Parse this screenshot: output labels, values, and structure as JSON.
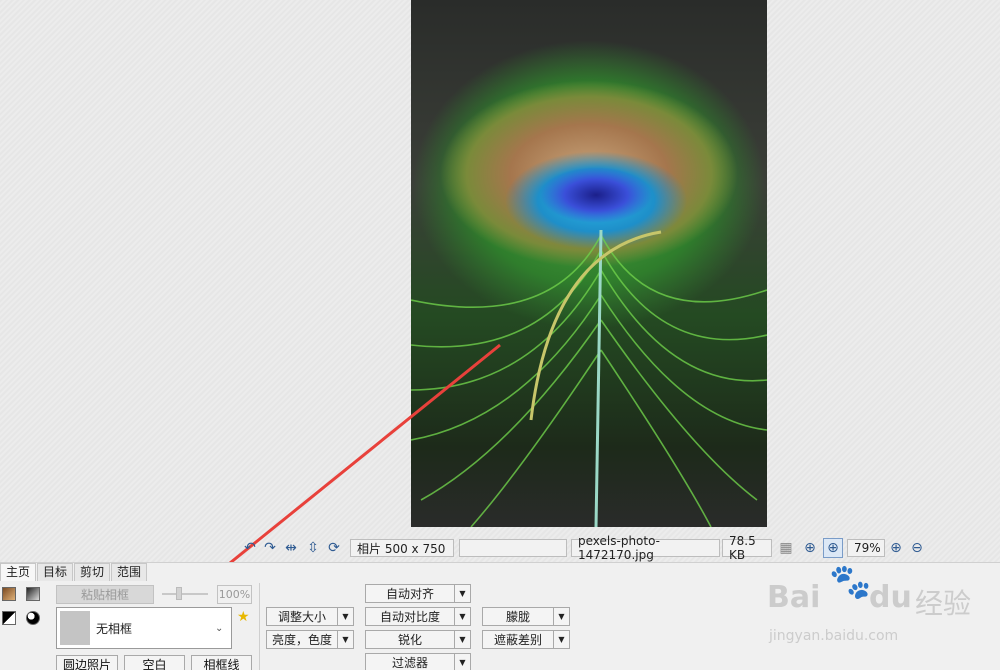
{
  "status_bar": {
    "image_size": "相片 500 x 750",
    "empty_field": "",
    "filename": "pexels-photo-1472170.jpg",
    "file_size": "78.5 KB",
    "zoom": "79%"
  },
  "tabs": [
    {
      "label": "主页"
    },
    {
      "label": "目标"
    },
    {
      "label": "剪切"
    },
    {
      "label": "范围"
    }
  ],
  "panel": {
    "paste_frame": "粘贴相框",
    "opacity": "100%",
    "frame_selected": "无相框",
    "round_photo": "圆边照片",
    "blank": "空白",
    "frame_line": "相框线",
    "resize": "调整大小",
    "brightness_color": "亮度，色度",
    "auto_align": "自动对齐",
    "auto_contrast": "自动对比度",
    "sharpen": "锐化",
    "filter": "过滤器",
    "blur": "朦胧",
    "mask_diff": "遮蔽差别"
  },
  "watermark": {
    "brand": "Bai",
    "brand2": "du",
    "suffix": "经验",
    "url": "jingyan.baidu.com"
  },
  "colors": {
    "arrow": "#e8413b",
    "accent_icon": "#2f5b92"
  }
}
